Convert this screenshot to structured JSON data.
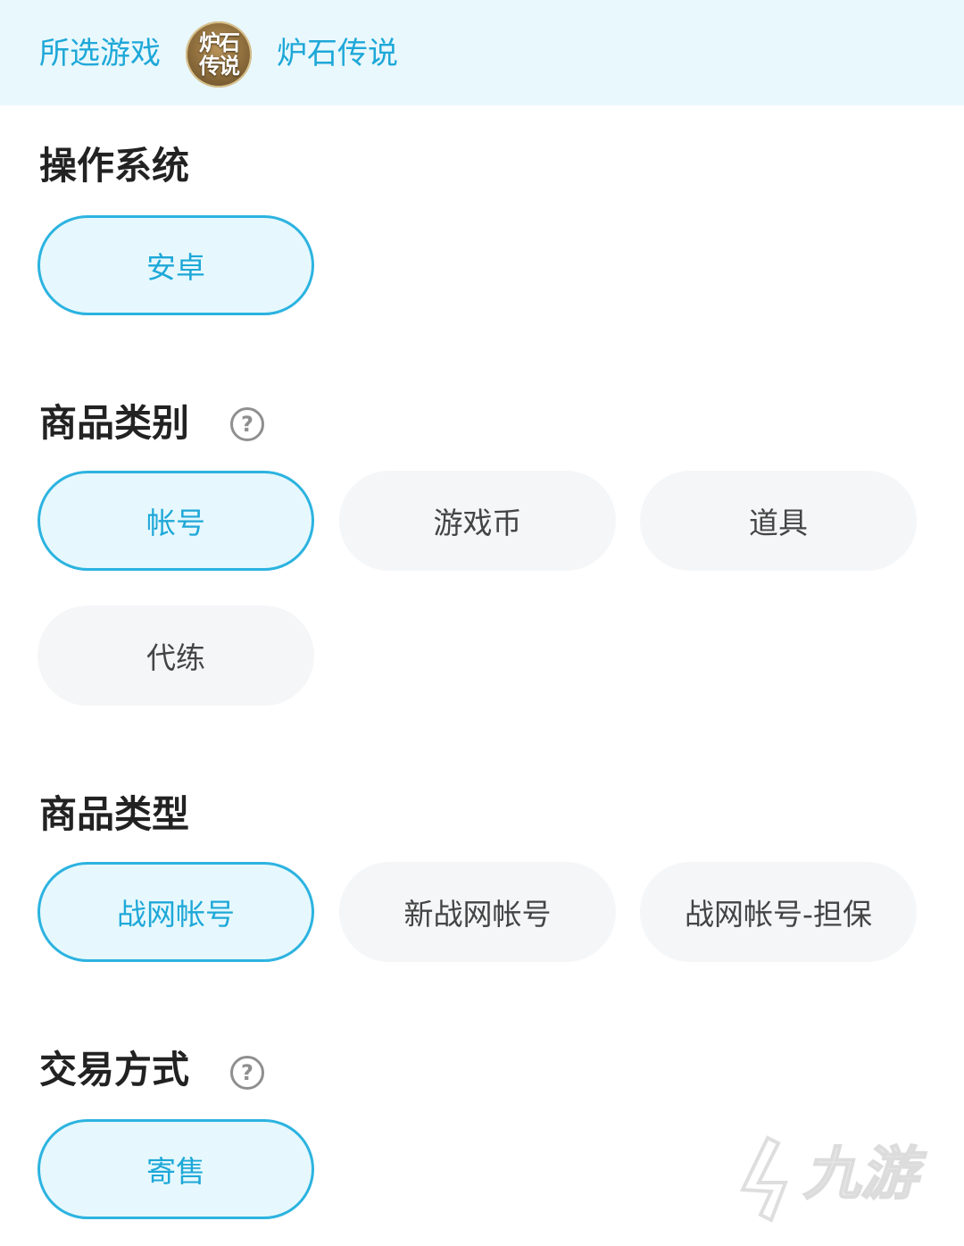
{
  "header": {
    "label": "所选游戏",
    "logo_line1": "炉石",
    "logo_line2": "传说",
    "game_name": "炉石传说"
  },
  "sections": {
    "os": {
      "title": "操作系统",
      "options": [
        "安卓"
      ],
      "selected": 0
    },
    "category": {
      "title": "商品类别",
      "options": [
        "帐号",
        "游戏币",
        "道具",
        "代练"
      ],
      "selected": 0
    },
    "type": {
      "title": "商品类型",
      "options": [
        "战网帐号",
        "新战网帐号",
        "战网帐号-担保"
      ],
      "selected": 0
    },
    "trade": {
      "title": "交易方式",
      "options": [
        "寄售"
      ],
      "selected": 0
    }
  },
  "help_glyph": "?",
  "watermark": "九游",
  "colors": {
    "accent": "#1ea8d8",
    "selected_bg": "#e6f8fd",
    "unselected_bg": "#f5f6f8",
    "header_bg": "#e9f8fd"
  }
}
